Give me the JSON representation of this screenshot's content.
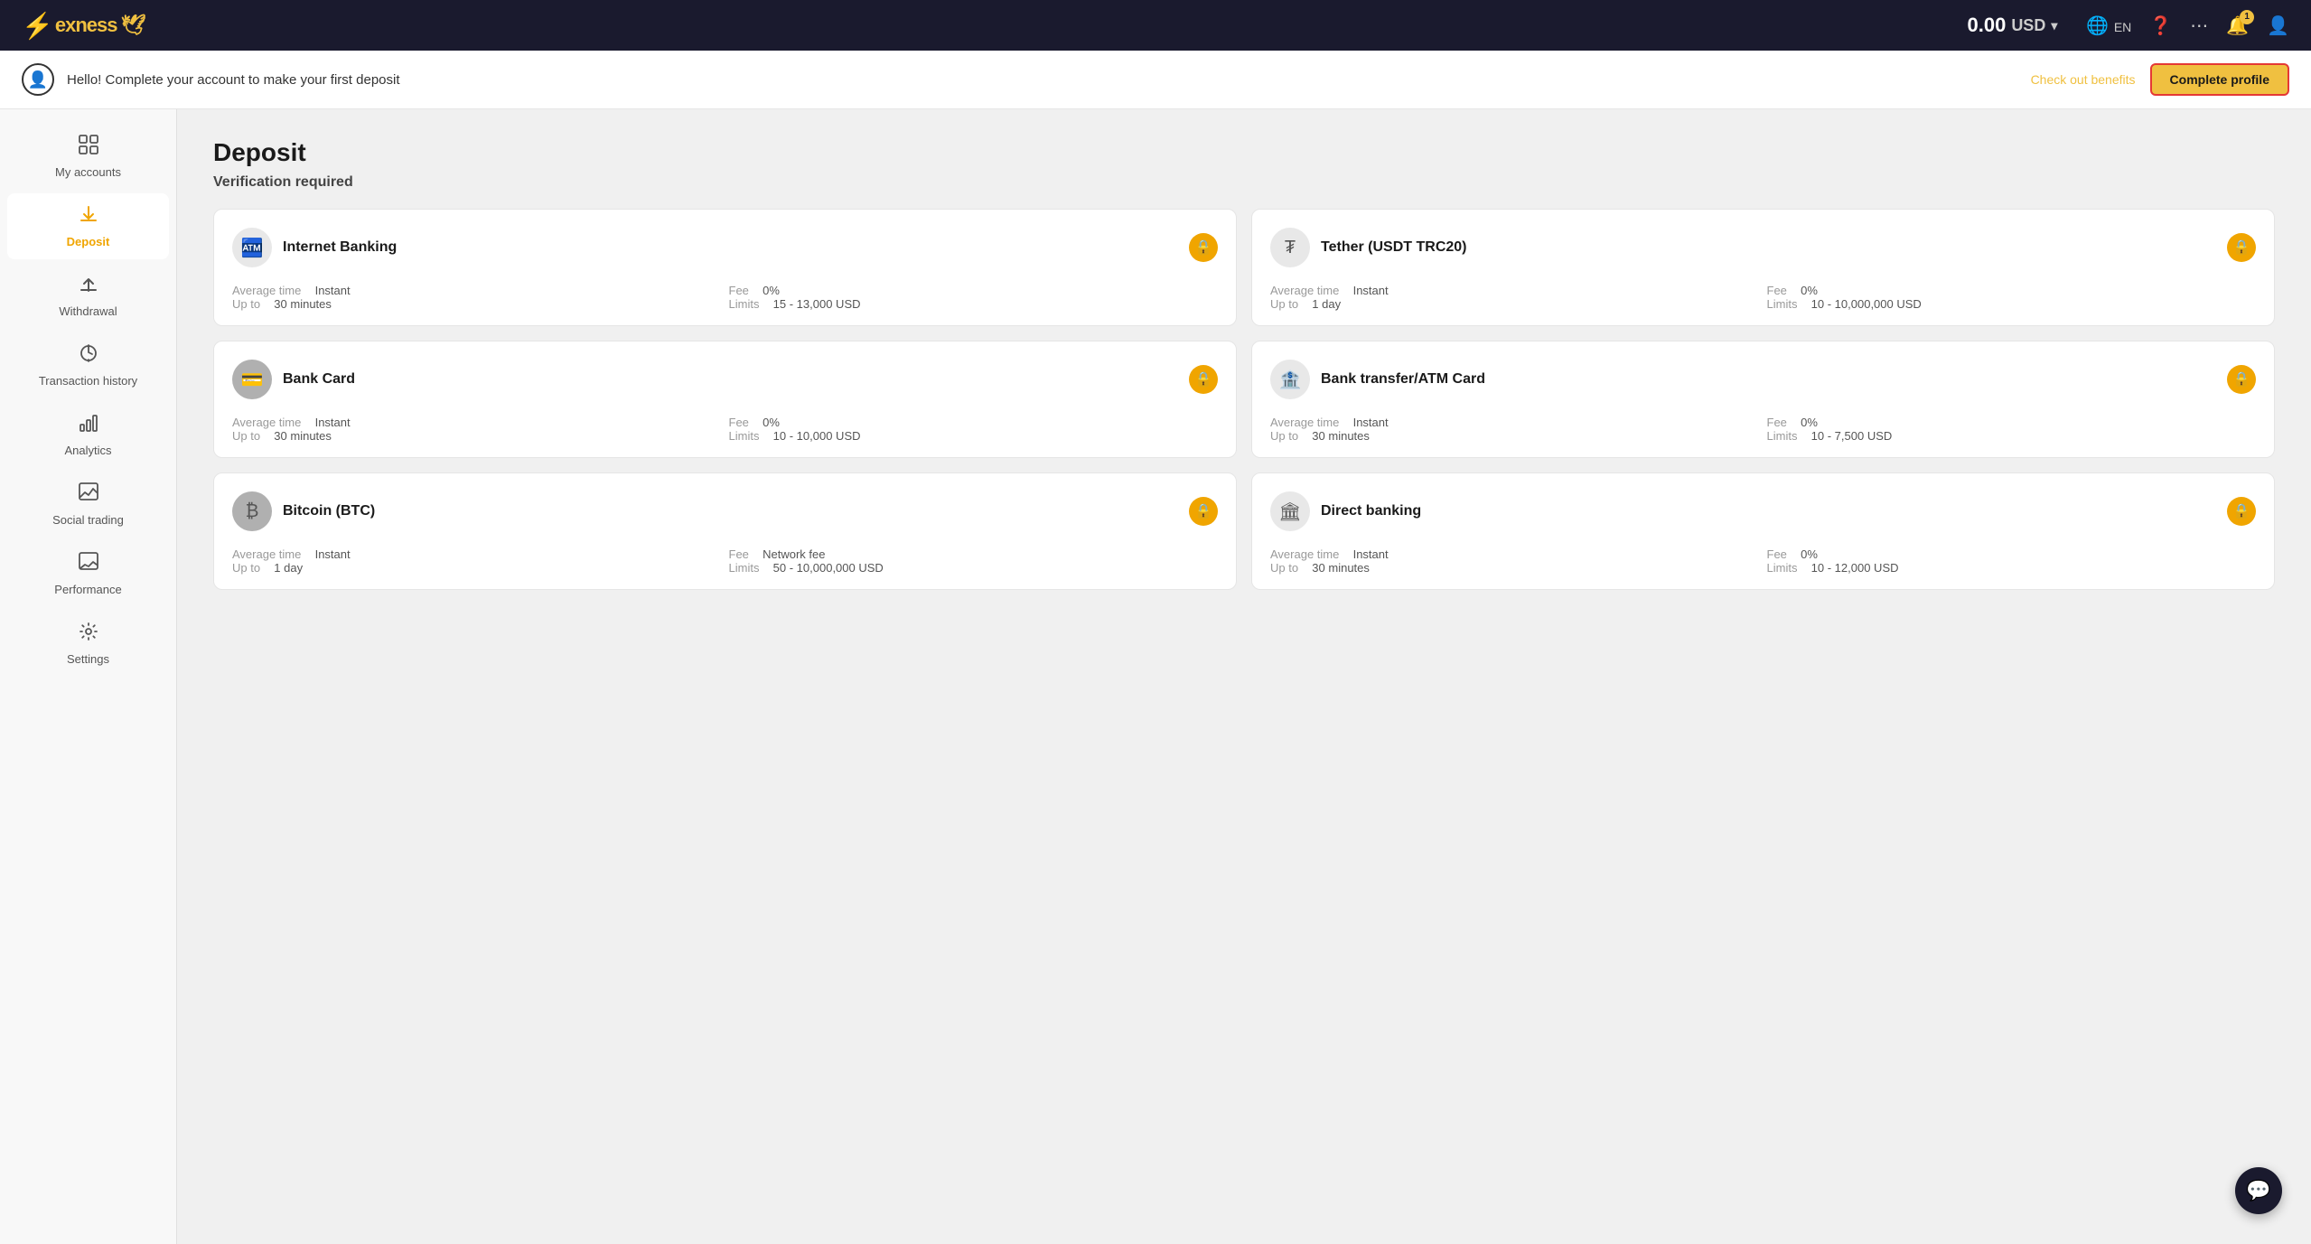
{
  "topnav": {
    "logo": "exness",
    "balance": "0.00",
    "currency": "USD",
    "lang": "EN",
    "notification_count": "1"
  },
  "banner": {
    "message": "Hello! Complete your account to make your first deposit",
    "check_out_label": "Check out benefits",
    "complete_label": "Complete profile"
  },
  "sidebar": {
    "items": [
      {
        "id": "my-accounts",
        "label": "My accounts",
        "icon": "⊞"
      },
      {
        "id": "deposit",
        "label": "Deposit",
        "icon": "⬇"
      },
      {
        "id": "withdrawal",
        "label": "Withdrawal",
        "icon": "⬆"
      },
      {
        "id": "transaction-history",
        "label": "Transaction history",
        "icon": "⧖"
      },
      {
        "id": "analytics",
        "label": "Analytics",
        "icon": "📊"
      },
      {
        "id": "social-trading",
        "label": "Social trading",
        "icon": "📈"
      },
      {
        "id": "performance",
        "label": "Performance",
        "icon": "📉"
      },
      {
        "id": "settings",
        "label": "Settings",
        "icon": "⚙"
      }
    ]
  },
  "page": {
    "title": "Deposit",
    "subtitle": "Verification required"
  },
  "payment_methods": [
    {
      "id": "internet-banking",
      "name": "Internet Banking",
      "icon_text": "🏧",
      "icon_class": "internet-banking",
      "avg_time_label": "Average time",
      "avg_time_val": "Instant",
      "up_to_label": "Up to",
      "up_to_val": "30 minutes",
      "fee_label": "Fee",
      "fee_val": "0%",
      "limits_label": "Limits",
      "limits_val": "15 - 13,000 USD",
      "locked": true
    },
    {
      "id": "tether",
      "name": "Tether (USDT TRC20)",
      "icon_text": "₮",
      "icon_class": "tether",
      "avg_time_label": "Average time",
      "avg_time_val": "Instant",
      "up_to_label": "Up to",
      "up_to_val": "1 day",
      "fee_label": "Fee",
      "fee_val": "0%",
      "limits_label": "Limits",
      "limits_val": "10 - 10,000,000 USD",
      "locked": true
    },
    {
      "id": "bank-card",
      "name": "Bank Card",
      "icon_text": "💳",
      "icon_class": "bank-card",
      "avg_time_label": "Average time",
      "avg_time_val": "Instant",
      "up_to_label": "Up to",
      "up_to_val": "30 minutes",
      "fee_label": "Fee",
      "fee_val": "0%",
      "limits_label": "Limits",
      "limits_val": "10 - 10,000 USD",
      "locked": true
    },
    {
      "id": "bank-transfer-atm",
      "name": "Bank transfer/ATM Card",
      "icon_text": "🏦",
      "icon_class": "bank-transfer",
      "avg_time_label": "Average time",
      "avg_time_val": "Instant",
      "up_to_label": "Up to",
      "up_to_val": "30 minutes",
      "fee_label": "Fee",
      "fee_val": "0%",
      "limits_label": "Limits",
      "limits_val": "10 - 7,500 USD",
      "locked": true
    },
    {
      "id": "bitcoin",
      "name": "Bitcoin (BTC)",
      "icon_text": "₿",
      "icon_class": "bitcoin",
      "avg_time_label": "Average time",
      "avg_time_val": "Instant",
      "up_to_label": "Up to",
      "up_to_val": "1 day",
      "fee_label": "Fee",
      "fee_val": "Network fee",
      "limits_label": "Limits",
      "limits_val": "50 - 10,000,000 USD",
      "locked": true
    },
    {
      "id": "direct-banking",
      "name": "Direct banking",
      "icon_text": "🏛",
      "icon_class": "direct-banking",
      "avg_time_label": "Average time",
      "avg_time_val": "Instant",
      "up_to_label": "Up to",
      "up_to_val": "30 minutes",
      "fee_label": "Fee",
      "fee_val": "0%",
      "limits_label": "Limits",
      "limits_val": "10 - 12,000 USD",
      "locked": true
    }
  ],
  "chat_icon": "💬"
}
